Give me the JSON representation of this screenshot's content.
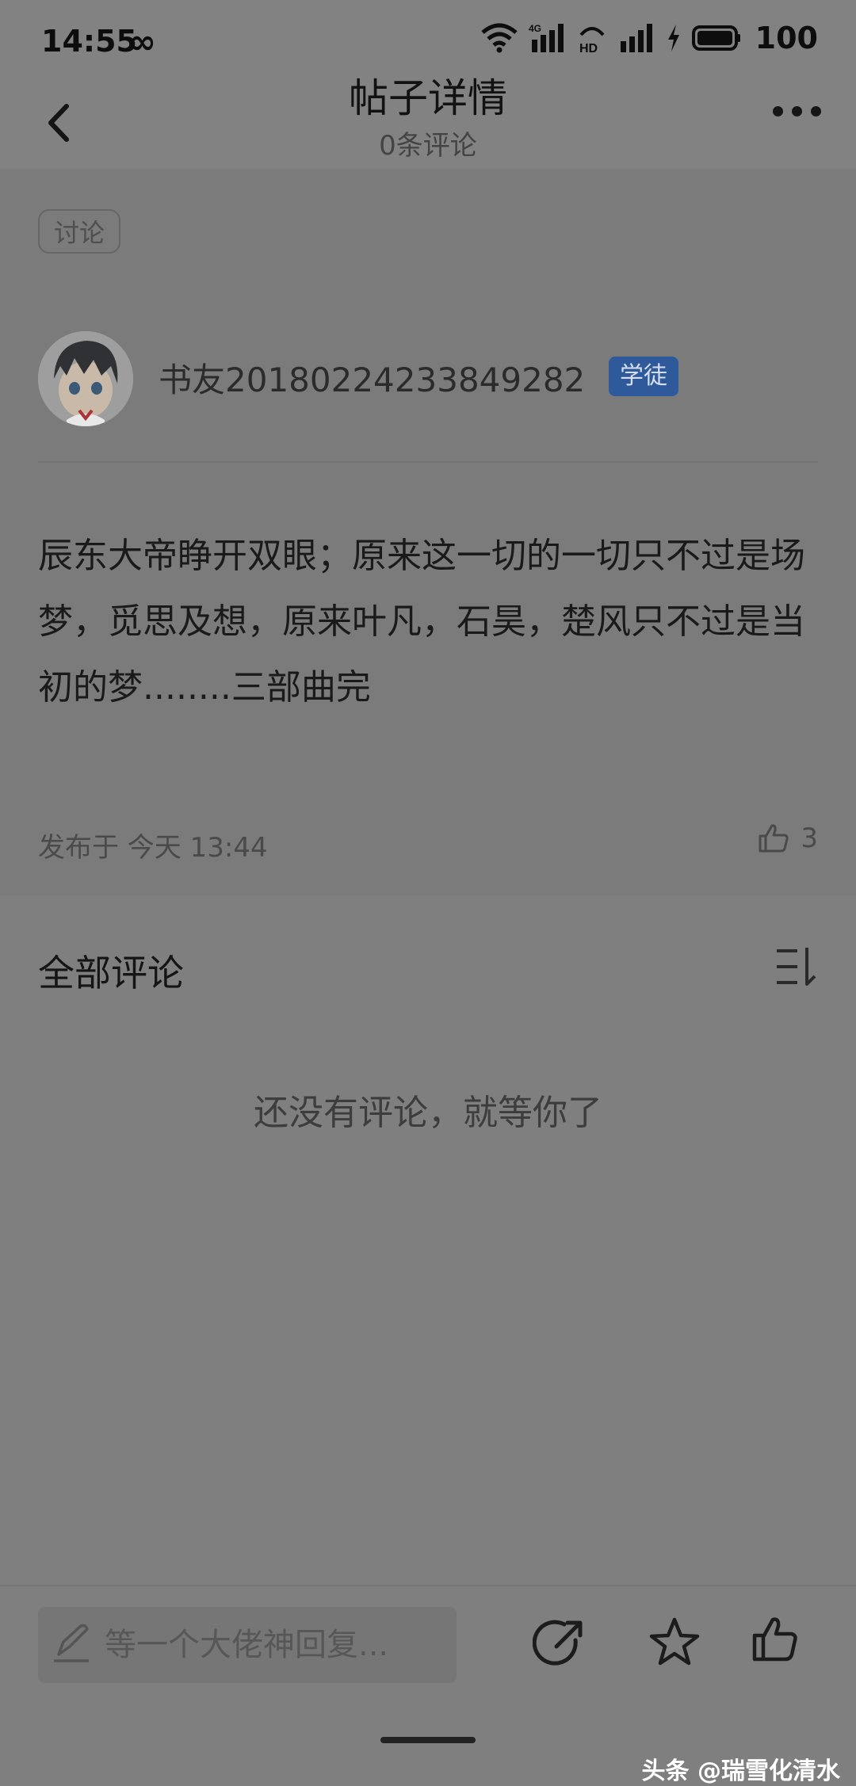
{
  "status_bar": {
    "time": "14:55",
    "infinity": "∞",
    "network_label": "4G",
    "hd_label": "HD",
    "battery": "100"
  },
  "nav": {
    "title": "帖子详情",
    "subtitle": "0条评论"
  },
  "post": {
    "tag": "讨论",
    "username": "书友20180224233849282",
    "badge": "学徒",
    "body": "辰东大帝睁开双眼；原来这一切的一切只不过是场梦，觅思及想，原来叶凡，石昊，楚风只不过是当初的梦........三部曲完",
    "posted_at": "发布于  今天 13:44",
    "like_count": "3"
  },
  "comments": {
    "title": "全部评论",
    "empty_text": "还没有评论，就等你了"
  },
  "bottom_bar": {
    "reply_placeholder": "等一个大佬神回复..."
  },
  "watermark": "头条 @瑞雪化清水"
}
